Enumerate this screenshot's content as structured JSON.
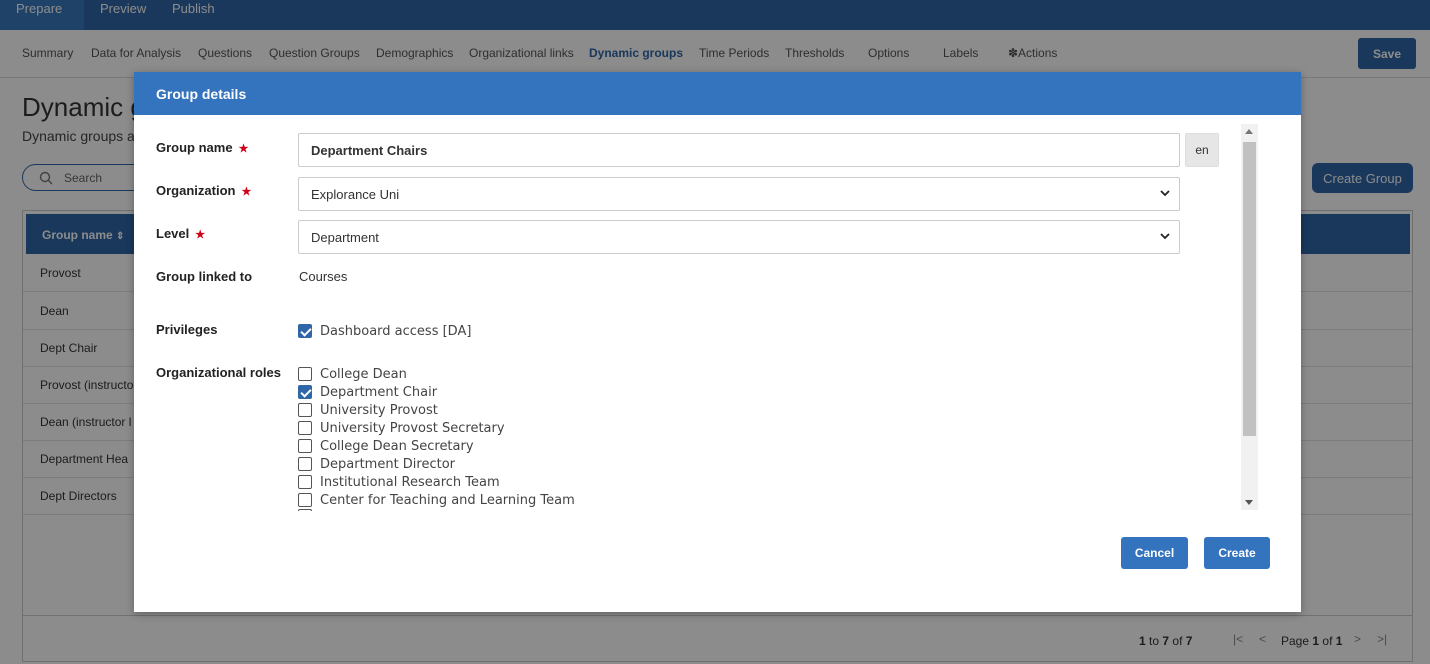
{
  "top_tabs": [
    {
      "label": "Prepare",
      "active": true
    },
    {
      "label": "Preview",
      "active": false
    },
    {
      "label": "Publish",
      "active": false
    }
  ],
  "subnav": [
    {
      "label": "Summary"
    },
    {
      "label": "Data for Analysis"
    },
    {
      "label": "Questions"
    },
    {
      "label": "Question Groups"
    },
    {
      "label": "Demographics"
    },
    {
      "label": "Organizational links"
    },
    {
      "label": "Dynamic groups",
      "active": true
    },
    {
      "label": "Time Periods"
    },
    {
      "label": "Thresholds"
    },
    {
      "label": "Options"
    },
    {
      "label": "Labels"
    },
    {
      "label": "✽Actions"
    }
  ],
  "save_label": "Save",
  "page": {
    "title": "Dynamic g",
    "description": "Dynamic groups a",
    "search_placeholder": "Search",
    "create_group_label": "Create Group",
    "table": {
      "header": "Group name",
      "rows": [
        "Provost",
        "Dean",
        "Dept Chair",
        "Provost (instructo",
        "Dean (instructor l",
        "Department Hea",
        "Dept Directors"
      ]
    },
    "pagination": {
      "range_prefix": "1",
      "range_mid": "to",
      "range_end": "7",
      "range_of": "of",
      "range_total": "7",
      "page_label": "Page",
      "page_current": "1",
      "page_of": "of",
      "page_total": "1"
    }
  },
  "modal": {
    "title": "Group details",
    "fields": {
      "group_name_label": "Group name",
      "group_name_value": "Department Chairs",
      "lang": "en",
      "organization_label": "Organization",
      "organization_value": "Explorance Uni",
      "level_label": "Level",
      "level_value": "Department",
      "linked_label": "Group linked to",
      "linked_value": "Courses",
      "privileges_label": "Privileges",
      "roles_label": "Organizational roles"
    },
    "privileges": [
      {
        "label": "Dashboard access [DA]",
        "checked": true
      }
    ],
    "roles": [
      {
        "label": "College Dean",
        "checked": false
      },
      {
        "label": "Department Chair",
        "checked": true
      },
      {
        "label": "University Provost",
        "checked": false
      },
      {
        "label": "University Provost Secretary",
        "checked": false
      },
      {
        "label": "College Dean Secretary",
        "checked": false
      },
      {
        "label": "Department Director",
        "checked": false
      },
      {
        "label": "Institutional Research Team",
        "checked": false
      },
      {
        "label": "Center for Teaching and Learning Team",
        "checked": false
      }
    ],
    "cancel_label": "Cancel",
    "create_label": "Create"
  },
  "colors": {
    "primary": "#2f66a8",
    "modal_header": "#3473bd",
    "required": "#d0021b"
  }
}
